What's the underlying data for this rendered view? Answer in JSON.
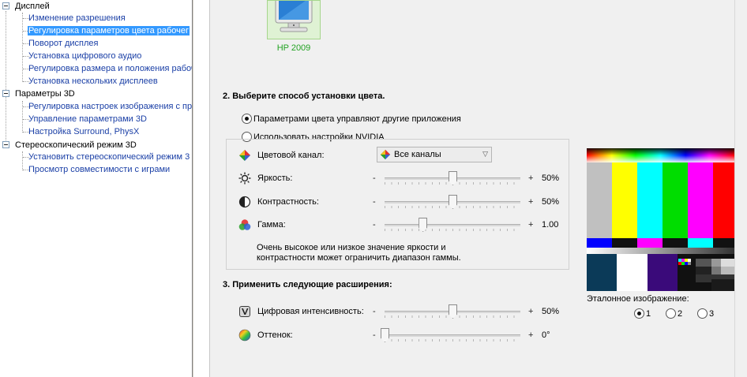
{
  "tree": {
    "items": [
      {
        "label": "Дисплей",
        "level": 0
      },
      {
        "label": "Изменение разрешения",
        "level": 1
      },
      {
        "label": "Регулировка параметров цвета рабочег",
        "level": 1,
        "selected": true
      },
      {
        "label": "Поворот дисплея",
        "level": 1
      },
      {
        "label": "Установка цифрового аудио",
        "level": 1
      },
      {
        "label": "Регулировка размера и положения рабоч",
        "level": 1
      },
      {
        "label": "Установка нескольких дисплеев",
        "level": 1
      },
      {
        "label": "Параметры 3D",
        "level": 0
      },
      {
        "label": "Регулировка настроек изображения с пр",
        "level": 1
      },
      {
        "label": "Управление параметрами 3D",
        "level": 1
      },
      {
        "label": "Настройка Surround, PhysX",
        "level": 1
      },
      {
        "label": "Стереоскопический режим 3D",
        "level": 0
      },
      {
        "label": "Установить стереоскопический режим 3",
        "level": 1
      },
      {
        "label": "Просмотр совместимости с играми",
        "level": 1
      }
    ]
  },
  "monitor": {
    "name": "HP 2009"
  },
  "section2": {
    "title": "2. Выберите способ установки цвета.",
    "option_other": "Параметрами цвета управляют другие приложения",
    "option_nvidia": "Использовать настройки NVIDIA",
    "selected_option": "option_other",
    "channel_label": "Цветовой канал:",
    "channel_value": "Все каналы",
    "brightness": {
      "label": "Яркость:",
      "minus": "-",
      "plus": "+",
      "value": "50%",
      "level": 0.5
    },
    "contrast": {
      "label": "Контрастность:",
      "minus": "-",
      "plus": "+",
      "value": "50%",
      "level": 0.5
    },
    "gamma": {
      "label": "Гамма:",
      "minus": "-",
      "plus": "+",
      "value": "1.00",
      "level": 0.28
    },
    "note_line1": "Очень высокое или низкое значение яркости и",
    "note_line2": "контрастности может ограничить диапазон гаммы."
  },
  "section3": {
    "title": "3. Применить следующие расширения:",
    "vibrance": {
      "label": "Цифровая интенсивность:",
      "minus": "-",
      "plus": "+",
      "value": "50%",
      "level": 0.5
    },
    "hue": {
      "label": "Оттенок:",
      "minus": "-",
      "plus": "+",
      "value": "0°",
      "level": 0.0
    }
  },
  "reference": {
    "label": "Эталонное изображение:",
    "options": [
      "1",
      "2",
      "3"
    ],
    "selected": "1"
  },
  "colors": {
    "selection": "#3399ff",
    "link": "#1a3fa6",
    "monitor_name": "#23a323",
    "panel_bg": "#f0f0f0"
  }
}
